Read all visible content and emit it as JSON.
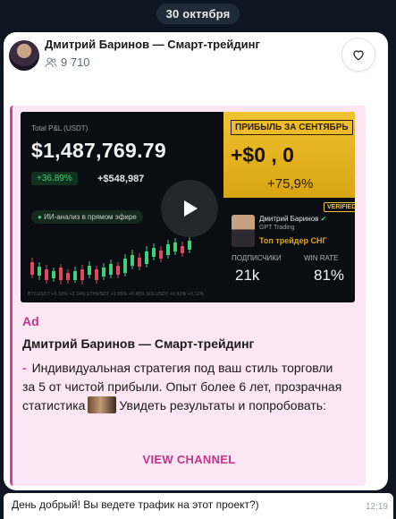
{
  "date_pill": "30 октября",
  "channel": {
    "name": "Дмитрий Баринов — Смарт-трейдинг",
    "subscribers": "9 710"
  },
  "media": {
    "pl_label": "Total P&L (USDT)",
    "pl_value": "$1,487,769.79",
    "pct_badge": "+36.89%",
    "usd_gain": "+$548,987",
    "ai_pill": "ИИ-анализ в прямом эфире",
    "profit_title": "ПРИБЫЛЬ ЗА СЕНТЯБРЬ",
    "profit_sum": "+$0   , 0",
    "profit_pct": "+75,9%",
    "verified": "VERIFIED",
    "trader_name": "Дмитрий Баринов",
    "trader_sub": "GPT Trading",
    "top_trader": "Топ трейдер СНГ",
    "subs_label": "ПОДПИСЧИКИ",
    "subs_value": "21k",
    "winrate_label": "WIN RATE",
    "winrate_value": "81%",
    "ticker": "BTCUSDT +0.18%  +2.14%   ETHUSDT +1.06%  +0.45%   SOLUSDT +0.82%  +0.12%"
  },
  "ad": {
    "label": "Ad",
    "title": "Дмитрий Баринов — Смарт-трейдинг",
    "text_part1": "Индивидуальная стратегия под ваш стиль торговли за 5 от чистой прибыли. Опыт более 6 лет, прозрачная статистика",
    "text_part2": "Увидеть результаты и попробовать:",
    "button": "VIEW CHANNEL"
  },
  "reply": {
    "text": "День добрый! Вы ведете трафик на этот проект?)",
    "time": "12:19"
  },
  "colors": {
    "background": "#0e1621",
    "accent_pink": "#c0358a",
    "ad_bg": "#fde6f4",
    "gold": "#f2c230"
  }
}
